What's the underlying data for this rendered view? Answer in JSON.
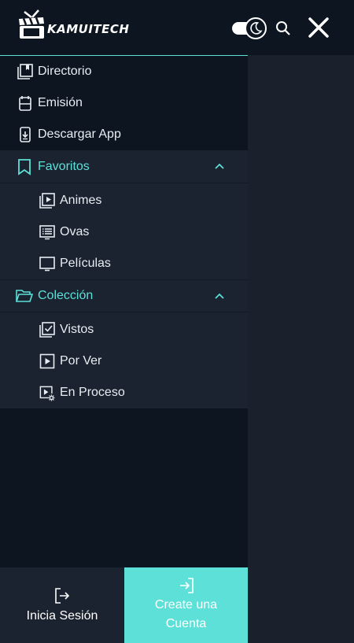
{
  "header": {
    "logo_text": "KAMUITECH",
    "theme_toggle_icon": "moon-icon",
    "search_icon": "search-icon",
    "close_icon": "close-icon"
  },
  "menu": {
    "items": [
      {
        "label": "Directorio",
        "icon": "book-icon"
      },
      {
        "label": "Emisión",
        "icon": "calendar-icon"
      },
      {
        "label": "Descargar App",
        "icon": "phone-download-icon"
      }
    ],
    "favoritos": {
      "label": "Favoritos",
      "icon": "bookmark-icon",
      "expanded": true,
      "items": [
        {
          "label": "Animes",
          "icon": "play-stack-icon"
        },
        {
          "label": "Ovas",
          "icon": "list-screen-icon"
        },
        {
          "label": "Películas",
          "icon": "monitor-icon"
        }
      ]
    },
    "coleccion": {
      "label": "Colección",
      "icon": "folder-open-icon",
      "expanded": true,
      "items": [
        {
          "label": "Vistos",
          "icon": "checkbox-stack-icon"
        },
        {
          "label": "Por Ver",
          "icon": "play-square-icon"
        },
        {
          "label": "En Proceso",
          "icon": "play-settings-icon"
        }
      ]
    }
  },
  "footer": {
    "login_label": "Inicia Sesión",
    "register_label": "Create una Cuenta"
  },
  "colors": {
    "accent": "#5ce0d8",
    "sidebar_bg": "#0d1521",
    "group_bg": "#1b2230",
    "page_bg": "#1b212c"
  }
}
